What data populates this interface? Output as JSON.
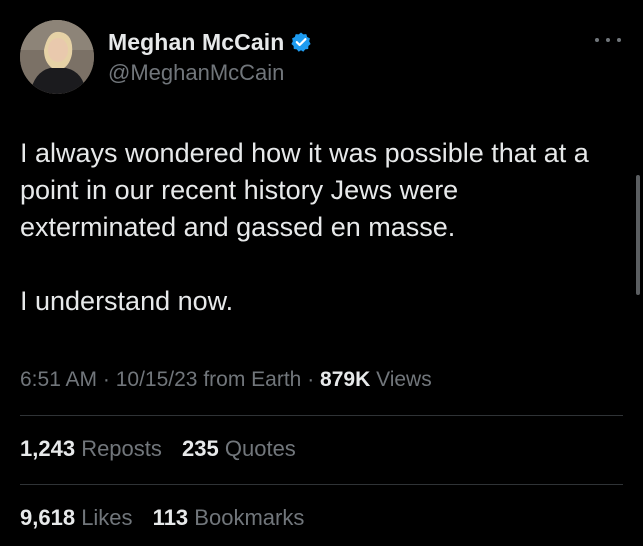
{
  "author": {
    "display_name": "Meghan McCain",
    "handle": "@MeghanMcCain",
    "verified": true,
    "avatar_icon": "profile-photo",
    "verified_icon": "verified-badge-icon"
  },
  "tweet": {
    "paragraphs": [
      "I always wondered how it was possible that at a point in our recent history Jews were exterminated and gassed en masse.",
      "I understand now."
    ]
  },
  "meta": {
    "time": "6:51 AM",
    "separator1": " · ",
    "date": "10/15/23",
    "source": " from Earth",
    "separator2": " · ",
    "views_count": "879K",
    "views_label": " Views"
  },
  "stats": {
    "reposts_count": "1,243",
    "reposts_label": "Reposts",
    "quotes_count": "235",
    "quotes_label": "Quotes",
    "likes_count": "9,618",
    "likes_label": "Likes",
    "bookmarks_count": "113",
    "bookmarks_label": "Bookmarks"
  },
  "colors": {
    "background": "#000000",
    "primary_text": "#e7e9ea",
    "secondary_text": "#71767b",
    "verified_blue": "#1d9bf0",
    "divider": "#2f3336"
  }
}
